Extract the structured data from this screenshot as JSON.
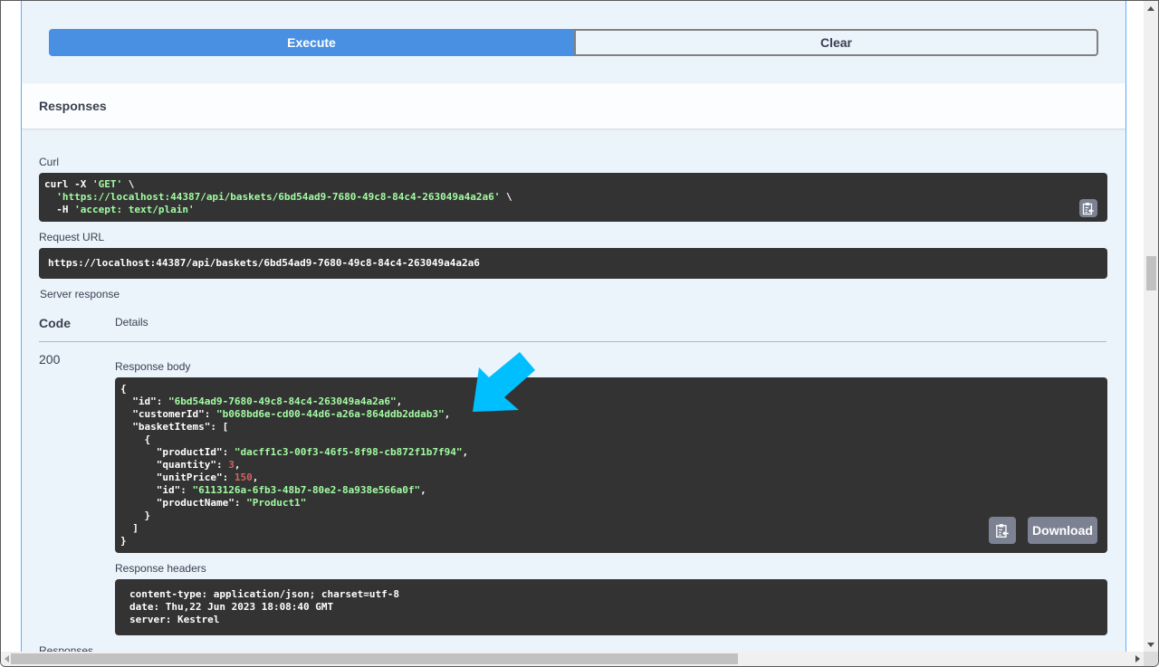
{
  "actions": {
    "execute_label": "Execute",
    "clear_label": "Clear"
  },
  "responses": {
    "title": "Responses",
    "curl_label": "Curl",
    "curl_lines": [
      "curl -X ",
      "'GET'",
      " \\",
      "'https://localhost:44387/api/baskets/6bd54ad9-7680-49c8-84c4-263049a4a2a6'",
      " \\",
      "-H ",
      "'accept: text/plain'"
    ],
    "request_url_label": "Request URL",
    "request_url": "https://localhost:44387/api/baskets/6bd54ad9-7680-49c8-84c4-263049a4a2a6",
    "server_response_label": "Server response",
    "code_header": "Code",
    "details_header": "Details",
    "status_code": "200",
    "response_body_label": "Response body",
    "response_body": {
      "id": "6bd54ad9-7680-49c8-84c4-263049a4a2a6",
      "customerId": "b068bd6e-cd00-44d6-a26a-864ddb2ddab3",
      "basketItems": [
        {
          "productId": "dacff1c3-00f3-46f5-8f98-cb872f1b7f94",
          "quantity": "3",
          "unitPrice": "150",
          "id": "6113126a-6fb3-48b7-80e2-8a938e566a0f",
          "productName": "Product1"
        }
      ]
    },
    "download_label": "Download",
    "response_headers_label": "Response headers",
    "response_headers": [
      "content-type: application/json; charset=utf-8",
      "date: Thu,22 Jun 2023 18:08:40 GMT",
      "server: Kestrel"
    ],
    "next_section_label": "Responses"
  },
  "icons": {
    "copy": "clipboard-copy-icon",
    "annotation": "arrow-pointer-icon"
  },
  "colors": {
    "execute": "#4990e2",
    "code_bg": "#333333",
    "string": "#a2fca2",
    "number": "#d36363",
    "annotation_arrow": "#00bfff"
  }
}
